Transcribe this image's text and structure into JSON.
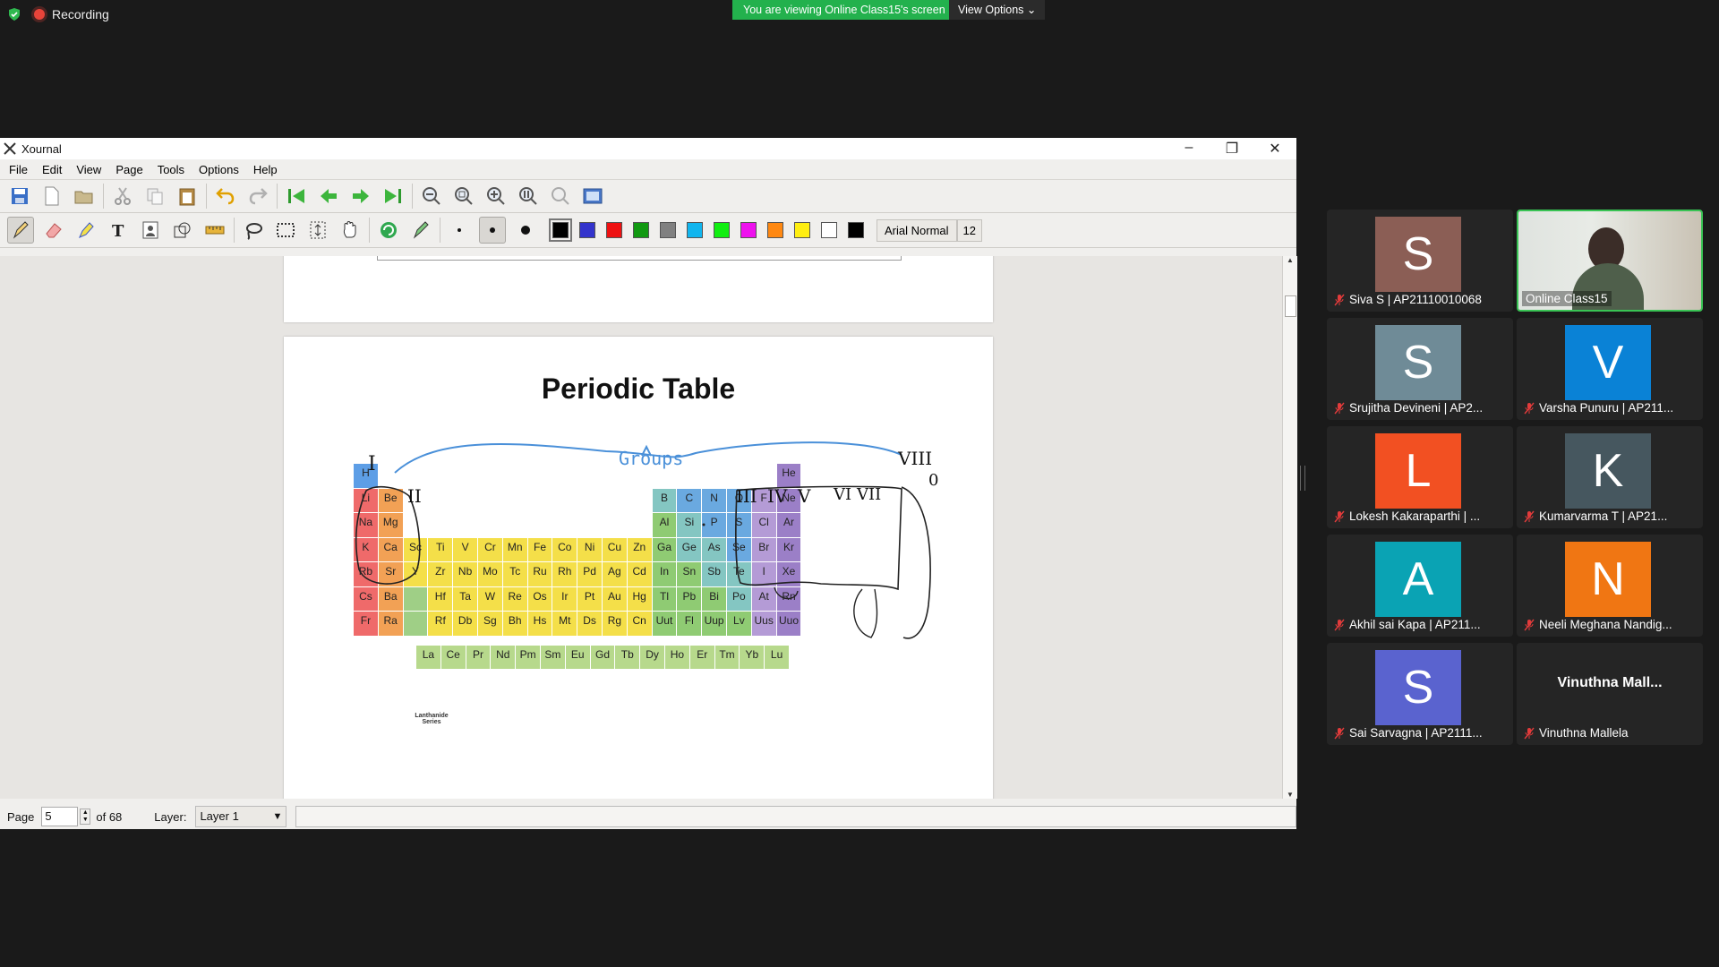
{
  "zoom": {
    "recording_label": "Recording",
    "viewing_banner": "You are viewing Online Class15's screen",
    "view_options_label": "View Options ⌄"
  },
  "window": {
    "title": "Xournal",
    "controls": [
      "–",
      "❐",
      "✕"
    ]
  },
  "menu": [
    "File",
    "Edit",
    "View",
    "Page",
    "Tools",
    "Options",
    "Help"
  ],
  "toolbar1_icons": [
    "save-icon",
    "new-page-icon",
    "open-icon",
    "cut-icon",
    "copy-icon",
    "paste-icon",
    "undo-icon",
    "redo-icon",
    "first-page-icon",
    "previous-page-icon",
    "next-page-icon",
    "last-page-icon",
    "zoom-out-icon",
    "zoom-fit-icon",
    "zoom-in-icon",
    "zoom-100-icon",
    "zoom-page-icon",
    "fullscreen-icon"
  ],
  "toolbar2": {
    "tools": [
      "pen-icon",
      "eraser-icon",
      "highlighter-icon",
      "text-icon",
      "image-icon",
      "shape-icon",
      "ruler-icon",
      "lasso-icon",
      "rect-select-icon",
      "vertical-space-icon",
      "hand-icon",
      "shape-recognizer-icon",
      "default-pen-icon"
    ],
    "colors": [
      "#000000",
      "#3333cc",
      "#ee1111",
      "#119911",
      "#808080",
      "#11b5ee",
      "#11ee11",
      "#ee11ee",
      "#ff8811",
      "#ffee11",
      "#ffffff",
      "#000000"
    ],
    "font_label": "Arial Normal",
    "font_size_label": "12"
  },
  "document": {
    "slide_title": "Periodic Table",
    "annotation_groups": "Groups",
    "annotation_roman": [
      "I",
      "II",
      "III",
      "IV",
      "V",
      "VI",
      "VII",
      "VIII",
      "0"
    ],
    "lanthanide_label": "Lanthanide Series",
    "elements_main": [
      [
        "H",
        "",
        "",
        "",
        "",
        "",
        "",
        "",
        "",
        "",
        "",
        "",
        "",
        "",
        "",
        "",
        "",
        "He"
      ],
      [
        "Li",
        "Be",
        "",
        "",
        "",
        "",
        "",
        "",
        "",
        "",
        "",
        "",
        "B",
        "C",
        "N",
        "O",
        "F",
        "Ne"
      ],
      [
        "Na",
        "Mg",
        "",
        "",
        "",
        "",
        "",
        "",
        "",
        "",
        "",
        "",
        "Al",
        "Si",
        "P",
        "S",
        "Cl",
        "Ar"
      ],
      [
        "K",
        "Ca",
        "Sc",
        "Ti",
        "V",
        "Cr",
        "Mn",
        "Fe",
        "Co",
        "Ni",
        "Cu",
        "Zn",
        "Ga",
        "Ge",
        "As",
        "Se",
        "Br",
        "Kr"
      ],
      [
        "Rb",
        "Sr",
        "Y",
        "Zr",
        "Nb",
        "Mo",
        "Tc",
        "Ru",
        "Rh",
        "Pd",
        "Ag",
        "Cd",
        "In",
        "Sn",
        "Sb",
        "Te",
        "I",
        "Xe"
      ],
      [
        "Cs",
        "Ba",
        "",
        "Hf",
        "Ta",
        "W",
        "Re",
        "Os",
        "Ir",
        "Pt",
        "Au",
        "Hg",
        "Tl",
        "Pb",
        "Bi",
        "Po",
        "At",
        "Rn"
      ],
      [
        "Fr",
        "Ra",
        "",
        "Rf",
        "Db",
        "Sg",
        "Bh",
        "Hs",
        "Mt",
        "Ds",
        "Rg",
        "Cn",
        "Uut",
        "Fl",
        "Uup",
        "Lv",
        "Uus",
        "Uuo"
      ]
    ],
    "elements_lanthanide": [
      "La",
      "Ce",
      "Pr",
      "Nd",
      "Pm",
      "Sm",
      "Eu",
      "Gd",
      "Tb",
      "Dy",
      "Ho",
      "Er",
      "Tm",
      "Yb",
      "Lu"
    ]
  },
  "statusbar": {
    "page_label": "Page",
    "page_value": "5",
    "page_total": "of 68",
    "layer_label": "Layer:",
    "layer_value": "Layer 1"
  },
  "participants": [
    {
      "initial": "S",
      "name": "Siva S | AP21110010068",
      "color": "#8b5e55",
      "muted": true
    },
    {
      "initial": "",
      "name": "Online Class15",
      "color": "",
      "muted": false,
      "video": true
    },
    {
      "initial": "S",
      "name": "Srujitha Devineni | AP2...",
      "color": "#6f8b97",
      "muted": true
    },
    {
      "initial": "V",
      "name": "Varsha Punuru | AP211...",
      "color": "#0a82d6",
      "muted": true
    },
    {
      "initial": "L",
      "name": "Lokesh Kakaraparthi | ...",
      "color": "#f25022",
      "muted": true
    },
    {
      "initial": "K",
      "name": "Kumarvarma T | AP21...",
      "color": "#46575f",
      "muted": true
    },
    {
      "initial": "A",
      "name": "Akhil sai Kapa | AP211...",
      "color": "#0aa3b4",
      "muted": true
    },
    {
      "initial": "N",
      "name": "Neeli Meghana Nandig...",
      "color": "#f07613",
      "muted": true
    },
    {
      "initial": "S",
      "name": "Sai Sarvagna | AP2111...",
      "color": "#5a63cf",
      "muted": true
    },
    {
      "initial": "",
      "name": "Vinuthna Mallela",
      "display": "Vinuthna Mall...",
      "color": "",
      "muted": true
    }
  ]
}
